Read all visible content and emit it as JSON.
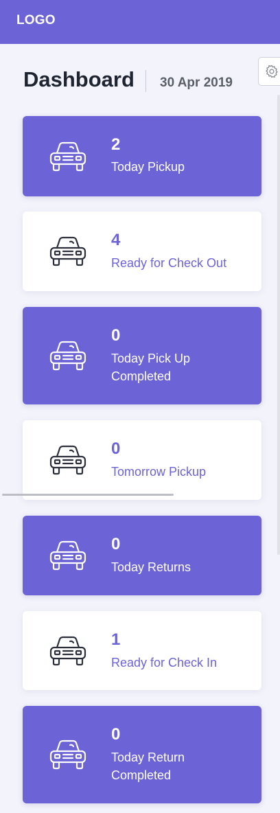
{
  "header": {
    "logo": "LOGO",
    "title": "Dashboard",
    "date": "30 Apr 2019"
  },
  "icons": {
    "settings": "gear-icon",
    "card": "car-icon"
  },
  "colors": {
    "accent": "#6c63d6",
    "background": "#f3f3fb",
    "card_plain": "#ffffff",
    "title_text": "#1f2530",
    "car_icon_dark": "#2a2f3a"
  },
  "cards": [
    {
      "count": "2",
      "label": "Today Pickup",
      "style": "filled"
    },
    {
      "count": "4",
      "label": "Ready for Check Out",
      "style": "plain"
    },
    {
      "count": "0",
      "label": "Today Pick Up Completed",
      "style": "filled"
    },
    {
      "count": "0",
      "label": "Tomorrow Pickup",
      "style": "plain"
    },
    {
      "count": "0",
      "label": "Today Returns",
      "style": "filled"
    },
    {
      "count": "1",
      "label": "Ready for Check In",
      "style": "plain"
    },
    {
      "count": "0",
      "label": "Today Return Completed",
      "style": "filled"
    }
  ]
}
